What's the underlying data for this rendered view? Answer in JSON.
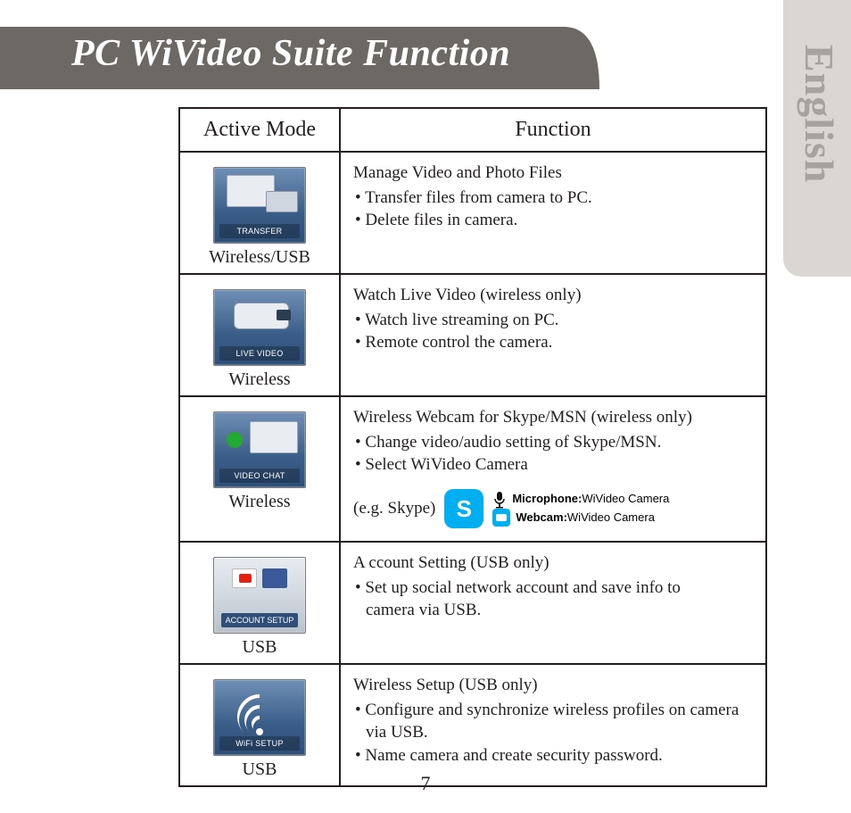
{
  "title": "PC WiVideo Suite Function",
  "language_tab": "English",
  "page_number": "7",
  "table": {
    "headers": {
      "mode": "Active Mode",
      "func": "Function"
    },
    "rows": [
      {
        "tile_label": "TRANSFER",
        "mode_caption": "Wireless/USB",
        "title": "Manage Video and Photo Files",
        "bullets": [
          "Transfer files from camera to PC.",
          "Delete files in camera."
        ]
      },
      {
        "tile_label": "LIVE VIDEO",
        "mode_caption": "Wireless",
        "title": "Watch Live Video (wireless only)",
        "bullets": [
          "Watch live streaming on PC.",
          "Remote control the camera."
        ]
      },
      {
        "tile_label": "VIDEO CHAT",
        "mode_caption": "Wireless",
        "title": "Wireless Webcam for Skype/MSN (wireless only)",
        "bullets": [
          "Change video/audio setting of Skype/MSN.",
          "Select WiVideo Camera"
        ],
        "example": {
          "prefix": "(e.g. Skype)",
          "mic_label": "Microphone:",
          "mic_value": "WiVideo Camera",
          "cam_label": "Webcam:",
          "cam_value": "WiVideo Camera"
        }
      },
      {
        "tile_label": "ACCOUNT SETUP",
        "mode_caption": "USB",
        "title": "A ccount Setting (USB only)",
        "bullets": [
          "Set up social network account and save info to",
          "camera via USB."
        ],
        "bullet_indent": [
          false,
          true
        ]
      },
      {
        "tile_label": "WiFi SETUP",
        "mode_caption": "USB",
        "title": "Wireless Setup (USB only)",
        "bullets": [
          "Configure and synchronize wireless profiles on camera",
          "via USB.",
          "Name camera and create security password."
        ],
        "bullet_indent": [
          false,
          true,
          false
        ]
      }
    ]
  }
}
